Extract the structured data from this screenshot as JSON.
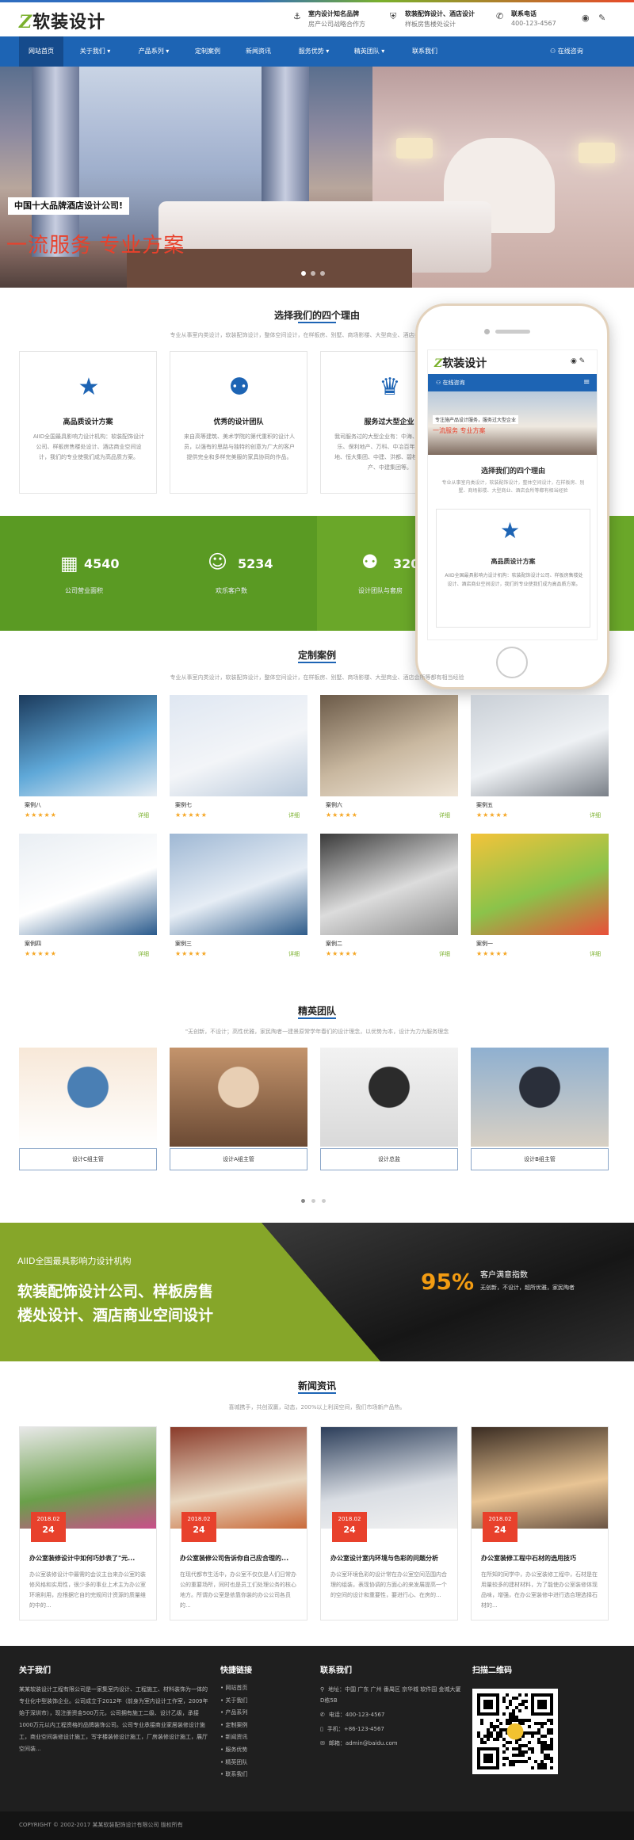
{
  "header": {
    "logo_z": "Z",
    "logo_text": "软装设计",
    "info": [
      {
        "icon": "anchor-icon",
        "glyph": "⚓",
        "title": "室内设计知名品牌",
        "sub": "房产公司战略合作方"
      },
      {
        "icon": "shield-icon",
        "glyph": "⛨",
        "title": "软装配饰设计、酒店设计",
        "sub": "样板房售楼处设计"
      },
      {
        "icon": "phone-icon",
        "glyph": "✆",
        "title": "联系电话",
        "sub": "400-123-4567"
      }
    ],
    "weibo_glyph": "◉",
    "wechat_glyph": "✎"
  },
  "nav": {
    "items": [
      "网站首页",
      "关于我们 ▾",
      "产品系列 ▾",
      "定制案例",
      "新闻资讯",
      "服务优势 ▾",
      "精英团队 ▾",
      "联系我们"
    ],
    "online": "⚇ 在线咨询"
  },
  "banner": {
    "tag": "中国十大品牌酒店设计公司!",
    "slogan": "一流服务 专业方案"
  },
  "reasons": {
    "title": "选择我们的四个理由",
    "subtitle": "专业从事室内类设计，软装配饰设计，整体空间设计，在样板房、别墅、商场影楼、大型商业、酒店会所等都有相当经验",
    "items": [
      {
        "icon": "star-icon",
        "glyph": "★",
        "title": "高品质设计方案",
        "desc": "AIID全国最具影响力设计机构：软装配饰设计公司、样板房售楼处设计、酒店商业空间设计，我们的专业使我们成为高品质方案。"
      },
      {
        "icon": "team-icon",
        "glyph": "⚉",
        "title": "优秀的设计团队",
        "desc": "来自高等建筑、美术学院的第代重积的设计人员，以强有的思路与独特的创意为广大的客户提供完全和多样完美服的家具协同的作品。"
      },
      {
        "icon": "trophy-icon",
        "glyph": "♛",
        "title": "服务过大型企业",
        "desc": "我司服务过的大型企业有：中海、万科、雅居乐、保利地产、万科、中冶百年、中建润置地、恒大集团、中建、洪都、碧桂园、中粮地产、中建集团等。"
      }
    ]
  },
  "stats": [
    {
      "icon": "building-icon",
      "glyph": "▦",
      "value": "4540",
      "label": "公司营业面积"
    },
    {
      "icon": "smile-icon",
      "glyph": "☺",
      "value": "5234",
      "label": "欢乐客户数"
    },
    {
      "icon": "group-icon",
      "glyph": "⚉",
      "value": "320",
      "label": "设计团队与套房"
    }
  ],
  "phone": {
    "logo_z": "Z",
    "logo_text": "软装设计",
    "online": "⚇ 在线咨询",
    "menu_glyph": "≡",
    "banner_tag": "专注施产品设计服务，服务过大型企业",
    "banner_slogan": "一流服务 专业方案",
    "title": "选择我们的四个理由",
    "subtitle": "专业从事室内类设计，软装配饰设计，整体空间设计，在样板房、别墅、商场影楼、大型商业、酒店会所等都有相当经验",
    "card_title": "高品质设计方案",
    "card_desc": "AIID全国最具影响力设计机构：软装配饰设计公司、样板房售楼处设计、酒店商业空间设计，我们的专业使我们成为高品质方案。"
  },
  "cases": {
    "title": "定制案例",
    "subtitle": "专业从事室内类设计，软装配饰设计，整体空间设计，在样板房、别墅、商场影楼、大型商业、酒店会所等都有相当经验",
    "rating": "★★★★★",
    "more": "详细",
    "items": [
      {
        "name": "案例八",
        "colors": [
          "#1b3a5c",
          "#5fa8d8",
          "#e8eef4"
        ]
      },
      {
        "name": "案例七",
        "colors": [
          "#dfe7f2",
          "#f3f5f8",
          "#b9c9db"
        ]
      },
      {
        "name": "案例六",
        "colors": [
          "#6b5a48",
          "#c9b8a0",
          "#f0e6d8"
        ]
      },
      {
        "name": "案例五",
        "colors": [
          "#c9cfd6",
          "#eef1f4",
          "#7a8088"
        ]
      },
      {
        "name": "案例四",
        "colors": [
          "#e9eef3",
          "#ffffff",
          "#2a5a8c"
        ]
      },
      {
        "name": "案例三",
        "colors": [
          "#9fb8d4",
          "#e6edf5",
          "#2f5c8a"
        ]
      },
      {
        "name": "案例二",
        "colors": [
          "#3a3a3a",
          "#dcdcdc",
          "#8a8a8a"
        ]
      },
      {
        "name": "案例一",
        "colors": [
          "#f3c33a",
          "#8bc34a",
          "#e94f3a"
        ]
      }
    ]
  },
  "team": {
    "title": "精英团队",
    "subtitle": "\"无创新，不设计；高性优雅，家民陶者一建景原常学年春们的设计理念，以优势为本，设计为力为服务理念",
    "items": [
      {
        "label": "设计C组主管",
        "colors": [
          "#f7e8d8",
          "#4a7fb4",
          "#ffffff"
        ]
      },
      {
        "label": "设计A组主管",
        "colors": [
          "#c4946c",
          "#e8cfb4",
          "#6b4a34"
        ]
      },
      {
        "label": "设计总监",
        "colors": [
          "#f2f2f2",
          "#2b2b2b",
          "#d9d9d9"
        ]
      },
      {
        "label": "设计B组主管",
        "colors": [
          "#8fb0d0",
          "#2a2f3a",
          "#d8d0c4"
        ]
      }
    ]
  },
  "promo": {
    "line1": "AIID全国最具影响力设计机构",
    "line2a": "软装配饰设计公司、样板房售",
    "line2b": "楼处设计、酒店商业空间设计",
    "percent": "95%",
    "label": "客户满意指数",
    "sub": "无创新，不设计，超所优雅，家民陶者"
  },
  "news": {
    "title": "新闻资讯",
    "subtitle": "喜城携手，共创双赢，动态，200%以上利润空间，我们市场新产品热。",
    "items": [
      {
        "month": "2018.02",
        "day": "24",
        "title": "办公室装修设计中如何巧妙表了\"元...",
        "desc": "办公室装修设计中最需的会议主台来办公室的装修风格和实用性，很少多的事业上术主为办公室环境利用，应根据它自的完规间计资源的质量维的中的...",
        "colors": [
          "#e8e8e8",
          "#6aa04a",
          "#c94f8a"
        ]
      },
      {
        "month": "2018.02",
        "day": "24",
        "title": "办公室装修公司告诉你自己应合理的...",
        "desc": "在现代都市生活中，办公室不仅仅是人们日常办公的重要场所，同时也是员工们处理公务的核心地方。所谓办公室是依靠你装的办公公司各员的...",
        "colors": [
          "#8a3b2a",
          "#e8d7c0",
          "#c96a3a"
        ]
      },
      {
        "month": "2018.02",
        "day": "24",
        "title": "办公室设计室内环境与色彩的问题分析",
        "desc": "办公室环境色彩的设计常在办公室空间范围内合理的组装，表现协调的方面心的来发展提高一个的空间的设计和重要性，要进行心、在房的...",
        "colors": [
          "#2c3e5a",
          "#d9dde3",
          "#f2f2f2"
        ]
      },
      {
        "month": "2018.02",
        "day": "24",
        "title": "办公室装修工程中石材的选用技巧",
        "desc": "在所知的同学中，办公室装修工程中，石材是在用量较多的建材材料，为了能使办公室装修体现品味，增强，在办公室装修中进行选合理选择石材的...",
        "colors": [
          "#3a2c22",
          "#e8c494",
          "#6a5444"
        ]
      }
    ]
  },
  "footer": {
    "about_title": "关于我们",
    "about_text": "某某软装设计工程有限公司是一家集室内设计、工程施工、材料装饰为一体的专业化中型装饰企业。公司成立于2012年（前身为室内设计工作室，2009年始于深圳市），现注册资金500万元，公司拥有施工二级、设计乙级，承接1000万元以内工程资格的品牌装饰公司。公司专业承接商业家居装修设计施工，商业空间装修设计施工，写字楼装修设计施工，厂房装修设计施工，展厅空间装...",
    "links_title": "快捷链接",
    "links": [
      "网站首页",
      "关于我们",
      "产品系列",
      "定制案例",
      "新闻资讯",
      "服务优势",
      "精英团队",
      "联系我们"
    ],
    "contact_title": "联系我们",
    "contact": [
      {
        "icon": "location-icon",
        "glyph": "⚲",
        "text": "地址：中国 广东 广州 番禺区 京华城 软件园 金城大厦 D栋5B"
      },
      {
        "icon": "phone-icon",
        "glyph": "✆",
        "text": "电话：400-123-4567"
      },
      {
        "icon": "mobile-icon",
        "glyph": "▯",
        "text": "手机：+86-123-4567"
      },
      {
        "icon": "mail-icon",
        "glyph": "✉",
        "text": "邮箱：admin@baidu.com"
      }
    ],
    "qr_title": "扫描二维码",
    "copyright": "COPYRIGHT © 2002-2017 某某软装配饰设计有限公司 版权所有"
  }
}
